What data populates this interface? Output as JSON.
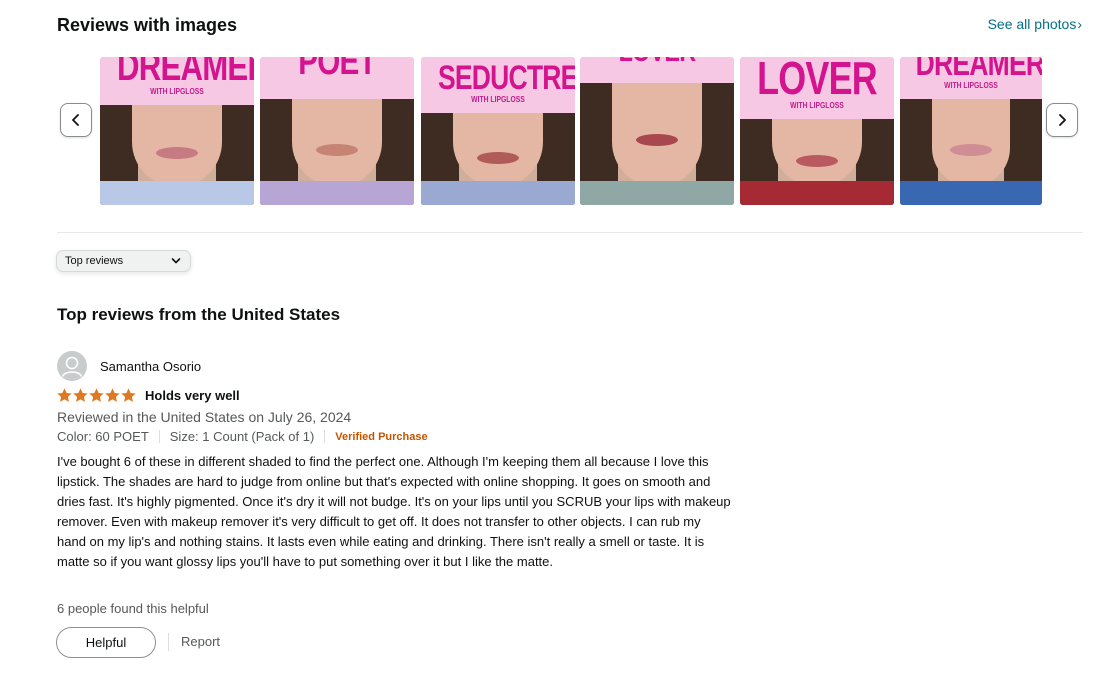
{
  "gallery": {
    "title": "Reviews with images",
    "see_all": "See all photos",
    "thumbnails": [
      {
        "word": "DREAMER",
        "sub": "WITH LIPGLOSS",
        "lip_color": "#c67b82",
        "shirt_color": "#b8c8e6"
      },
      {
        "word": "POET",
        "sub": "",
        "lip_color": "#c78474",
        "shirt_color": "#b7a5d6"
      },
      {
        "word": "SEDUCTRESS",
        "sub": "WITH LIPGLOSS",
        "lip_color": "#b05a5a",
        "shirt_color": "#9aa9d1"
      },
      {
        "word": "LOVER",
        "sub": "",
        "lip_color": "#a9474e",
        "shirt_color": "#8fa8a6"
      },
      {
        "word": "LOVER",
        "sub": "WITH LIPGLOSS",
        "lip_color": "#b95a61",
        "shirt_color": "#a52a33"
      },
      {
        "word": "DREAMER",
        "sub": "WITH LIPGLOSS",
        "lip_color": "#cf8d95",
        "shirt_color": "#3a67b1"
      }
    ]
  },
  "sort": {
    "selected": "Top reviews"
  },
  "reviews_heading": "Top reviews from the United States",
  "review": {
    "author": "Samantha Osorio",
    "rating": 5,
    "title": "Holds very well",
    "date": "Reviewed in the United States on July 26, 2024",
    "color": "Color: 60 POET",
    "size": "Size: 1 Count (Pack of 1)",
    "verified": "Verified Purchase",
    "body": "I've bought 6 of these in different shaded to find the perfect one. Although I'm keeping them all because I love this lipstick. The shades are hard to judge from online but that's expected with online shopping. It goes on smooth and dries fast. It's highly pigmented. Once it's dry it will not budge. It's on your lips until you SCRUB your lips with makeup remover. Even with makeup remover it's very difficult to get off. It does not transfer to other objects. I can rub my hand on my lip's and nothing stains. It lasts even while eating and drinking. There isn't really a smell or taste. It is matte so if you want glossy lips you'll have to put something over it but I like the matte.",
    "helpful_count": "6 people found this helpful",
    "helpful_label": "Helpful",
    "report_label": "Report"
  },
  "colors": {
    "link": "#007185",
    "star": "#de7921",
    "verified": "#c45500",
    "banner_pink": "#f7c8e4",
    "banner_text": "#d4148e"
  }
}
